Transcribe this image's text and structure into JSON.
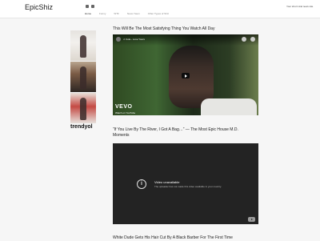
{
  "header": {
    "logo": "EpicShiz",
    "tagline": "Your short viral news site",
    "social_icons": [
      "facebook-icon",
      "instagram-icon"
    ],
    "nav": [
      "Home",
      "Funny",
      "WTF",
      "Never Seen",
      "Other Types of Shiz"
    ]
  },
  "sidebar": {
    "ad_caption": "trendyol"
  },
  "posts": [
    {
      "title": "This Will Be The Most Satisfying Thing You Watch All Day",
      "video": {
        "overlay_title": "J. Cole - Love Yours",
        "brand_text": "VEVO",
        "watch_label": "Watch on YouTube",
        "actions": [
          "Watch later",
          "Share"
        ]
      }
    },
    {
      "title_line1": "“If You Live By The River, I Got A Bag…” — The Most Epic House M.D.",
      "title_line2": "Moments",
      "video": {
        "unavailable_title": "Video unavailable",
        "unavailable_sub": "The uploader has not made this video available in your country."
      }
    },
    {
      "title": "White Dude Gets His Hair Cut By A Black Barber For The First Time"
    }
  ]
}
